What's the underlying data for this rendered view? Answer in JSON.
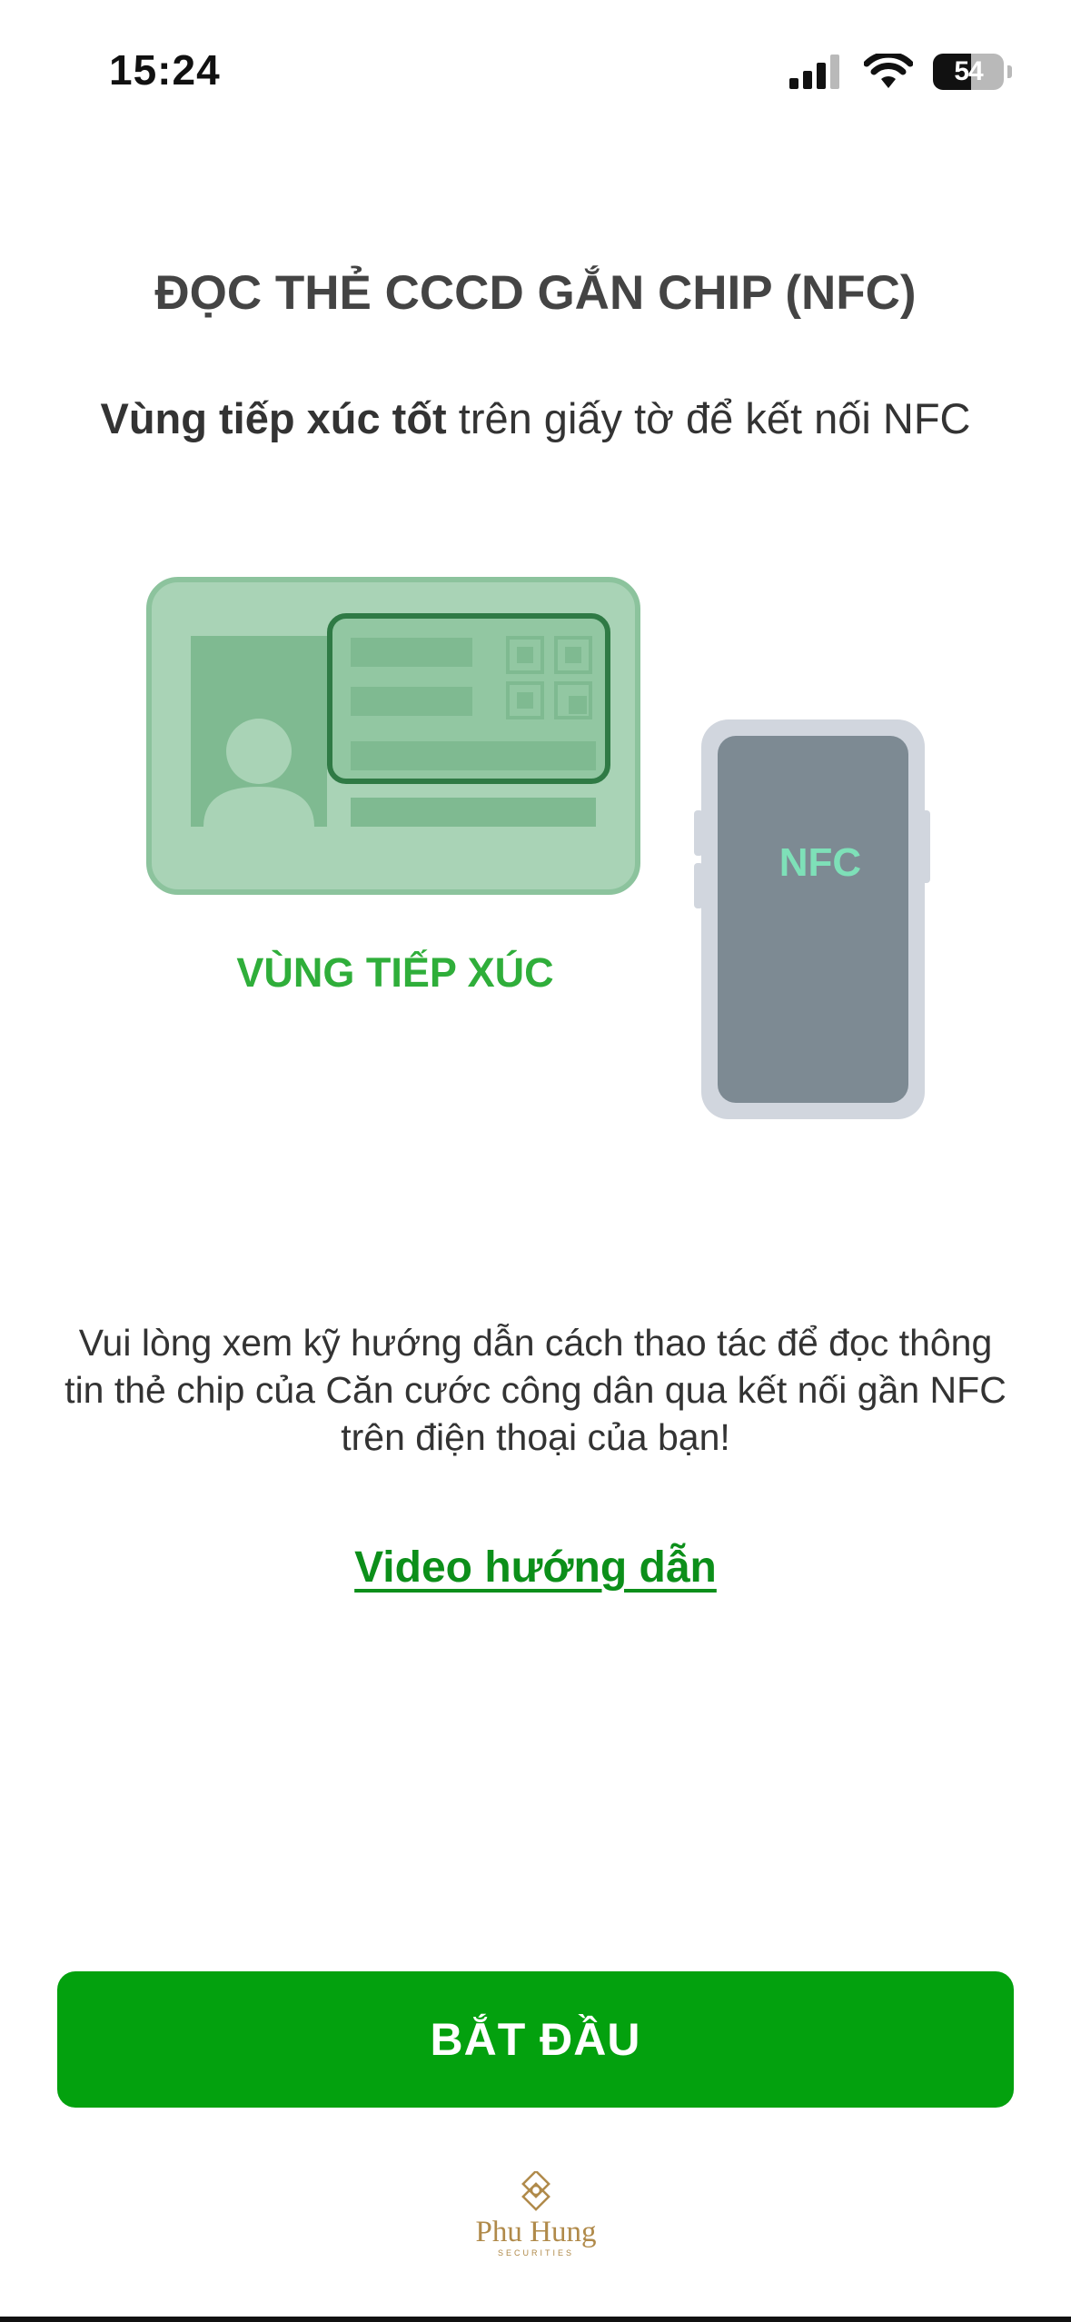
{
  "status_bar": {
    "time": "15:24",
    "battery": "54"
  },
  "header": {
    "title": "ĐỌC THẺ CCCD GẮN CHIP (NFC)",
    "subtitle_bold": "Vùng tiếp xúc tốt",
    "subtitle_rest": " trên giấy tờ để kết nối NFC"
  },
  "illustration": {
    "contact_label": "VÙNG TIẾP XÚC",
    "phone_label": "NFC"
  },
  "instruction": "Vui lòng xem kỹ hướng dẫn cách thao tác để đọc thông tin thẻ chip của Căn cước công dân qua kết nối gần NFC trên điện thoại của bạn!",
  "video_link": "Video hướng dẫn",
  "start_button": "BẮT ĐẦU",
  "brand": {
    "name": "Phu Hung",
    "subtitle": "SECURITIES"
  },
  "colors": {
    "primary_green": "#03a10e",
    "link_green": "#0c8f1a",
    "label_green": "#2fae3a",
    "card_green": "#a9d3b6",
    "nfc_text": "#7ee0b8"
  }
}
